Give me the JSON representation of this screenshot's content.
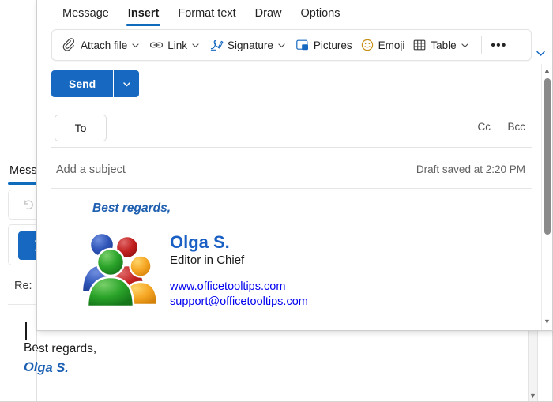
{
  "background_window": {
    "tab_label": "Mess",
    "undo_icon": "undo-icon",
    "send_icon": "send-paper-plane-icon",
    "subject_text": "Re: M",
    "body_line_1": "Best regards,",
    "body_line_2": "Olga S.",
    "scroll_down_glyph": "▼"
  },
  "ribbon": {
    "tabs": [
      {
        "label": "Message",
        "active": false
      },
      {
        "label": "Insert",
        "active": true
      },
      {
        "label": "Format text",
        "active": false
      },
      {
        "label": "Draw",
        "active": false
      },
      {
        "label": "Options",
        "active": false
      }
    ],
    "items": [
      {
        "label": "Attach file",
        "icon": "paperclip-icon",
        "has_chevron": true
      },
      {
        "label": "Link",
        "icon": "link-icon",
        "has_chevron": true
      },
      {
        "label": "Signature",
        "icon": "signature-pen-icon",
        "has_chevron": true
      },
      {
        "label": "Pictures",
        "icon": "pictures-icon",
        "has_chevron": false
      },
      {
        "label": "Emoji",
        "icon": "emoji-smiley-icon",
        "has_chevron": false
      },
      {
        "label": "Table",
        "icon": "table-grid-icon",
        "has_chevron": true
      }
    ],
    "overflow_label": "•••",
    "expand_icon": "chevron-down-icon"
  },
  "compose": {
    "send_label": "Send",
    "send_caret_icon": "chevron-down-icon",
    "to_label": "To",
    "to_value": "",
    "to_placeholder": "",
    "cc_label": "Cc",
    "bcc_label": "Bcc",
    "subject_placeholder": "Add a subject",
    "subject_value": "",
    "draft_status": "Draft saved at 2:20 PM"
  },
  "signature": {
    "greeting": "Best regards,",
    "logo_icon": "people-group-logo-icon",
    "name": "Olga S.",
    "title": "Editor in Chief",
    "website": "www.officetooltips.com",
    "email": "support@officetooltips.com"
  },
  "scrollbar": {
    "up_glyph": "▲",
    "down_glyph": "▼"
  },
  "colors": {
    "accent_blue": "#1668c1",
    "tab_underline": "#0f6cbd",
    "signature_name_blue": "#1a5fc4",
    "link_blue": "#0000ee",
    "greeting_blue": "#1f5fb0"
  }
}
